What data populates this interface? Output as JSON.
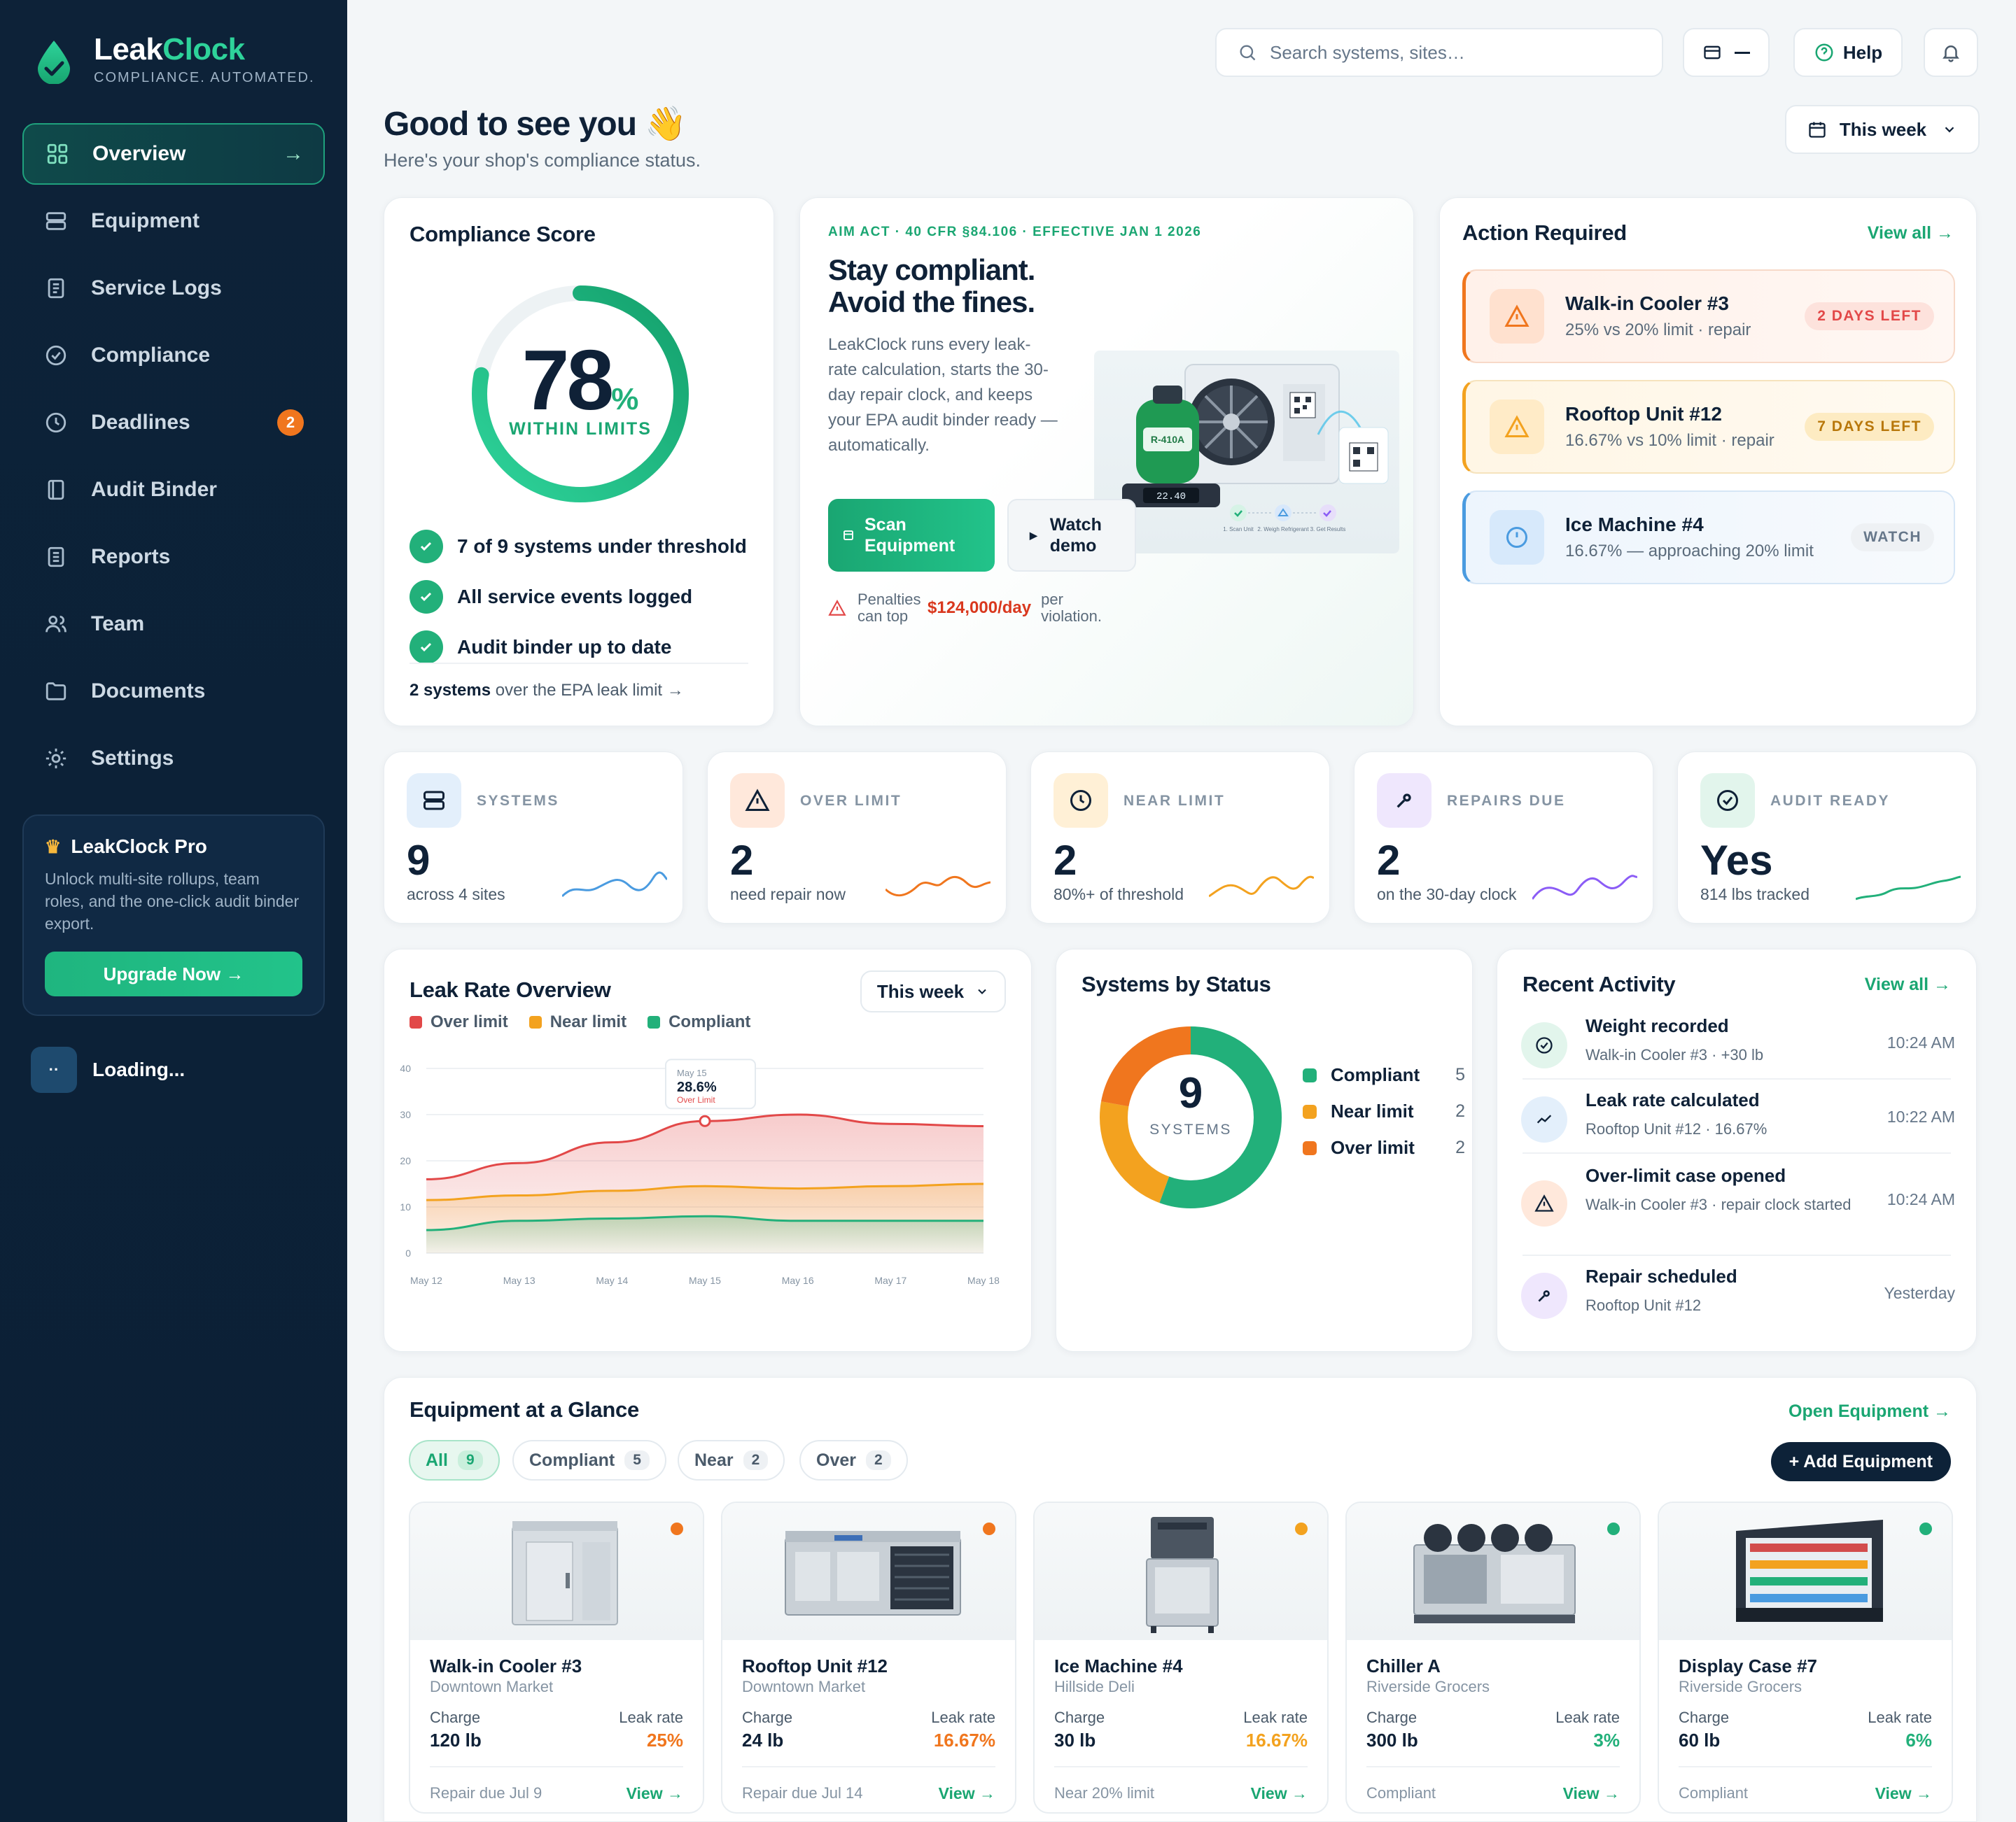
{
  "app": {
    "name_a": "Leak",
    "name_b": "Clock",
    "tagline": "COMPLIANCE. AUTOMATED."
  },
  "sidebar": {
    "items": [
      {
        "label": "Overview",
        "icon": "grid-icon",
        "active": true,
        "arrow": "→"
      },
      {
        "label": "Equipment",
        "icon": "server-icon"
      },
      {
        "label": "Service Logs",
        "icon": "document-icon"
      },
      {
        "label": "Compliance",
        "icon": "check-circle-icon"
      },
      {
        "label": "Deadlines",
        "icon": "clock-icon",
        "badge": "2"
      },
      {
        "label": "Audit Binder",
        "icon": "binder-icon"
      },
      {
        "label": "Reports",
        "icon": "report-icon"
      },
      {
        "label": "Team",
        "icon": "team-icon"
      },
      {
        "label": "Documents",
        "icon": "folder-icon"
      },
      {
        "label": "Settings",
        "icon": "gear-icon"
      }
    ],
    "pro": {
      "title": "LeakClock Pro",
      "desc": "Unlock multi-site rollups, team roles, and the one-click audit binder export.",
      "button": "Upgrade Now →"
    },
    "loading": {
      "dots": "··",
      "label": "Loading..."
    }
  },
  "topbar": {
    "search_placeholder": "Search systems, sites…",
    "help": "Help",
    "range": "This week"
  },
  "header": {
    "title": "Good to see you 👋",
    "subtitle": "Here's your shop's compliance status."
  },
  "score": {
    "title": "Compliance Score",
    "value": "78",
    "unit": "%",
    "percent": 78,
    "label": "WITHIN LIMITS",
    "checks": [
      "7 of 9 systems under threshold",
      "All service events logged",
      "Audit binder up to date"
    ],
    "footer_bold": "2 systems",
    "footer_rest": " over the EPA leak limit →"
  },
  "hero": {
    "eyebrow": "AIM ACT · 40 CFR §84.106 · EFFECTIVE JAN 1 2026",
    "title_1": "Stay compliant.",
    "title_2": "Avoid the fines.",
    "desc": "LeakClock runs every leak-rate calculation, starts the 30-day repair clock, and keeps your EPA audit binder ready — automatically.",
    "scan_btn": "Scan Equipment",
    "demo_btn": "Watch demo",
    "penalty_pre": "Penalties can top",
    "penalty_amount": "$124,000/day",
    "penalty_post": "per violation.",
    "illus": {
      "cylinder_label": "R-410A",
      "scale_readout": "22.40",
      "steps": [
        "1. Scan Unit",
        "2. Weigh Refrigerant",
        "3. Get Results"
      ]
    }
  },
  "actions": {
    "title": "Action Required",
    "view_all": "View all →",
    "items": [
      {
        "name": "Walk-in Cooler #3",
        "detail": "25% vs 20% limit · repair",
        "pill": "2 DAYS LEFT",
        "tone": "red"
      },
      {
        "name": "Rooftop Unit #12",
        "detail": "16.67% vs 10% limit · repair",
        "pill": "7 DAYS LEFT",
        "tone": "amber"
      },
      {
        "name": "Ice Machine #4",
        "detail": "16.67% — approaching 20% limit",
        "pill": "WATCH",
        "tone": "blue"
      }
    ]
  },
  "stats": [
    {
      "label": "SYSTEMS",
      "value": "9",
      "sub": "across 4 sites",
      "icon": "server-icon",
      "color": "#4a9be0"
    },
    {
      "label": "OVER LIMIT",
      "value": "2",
      "sub": "need repair now",
      "icon": "warning-icon",
      "color": "#f0761e"
    },
    {
      "label": "NEAR LIMIT",
      "value": "2",
      "sub": "80%+ of threshold",
      "icon": "clock-icon",
      "color": "#f3a21f"
    },
    {
      "label": "REPAIRS DUE",
      "value": "2",
      "sub": "on the 30-day clock",
      "icon": "wrench-icon",
      "color": "#8b5cf6"
    },
    {
      "label": "AUDIT READY",
      "value": "Yes",
      "sub": "814 lbs tracked",
      "icon": "check-circle-icon",
      "color": "#22b07a"
    }
  ],
  "leak_chart": {
    "title": "Leak Rate Overview",
    "range": "This week",
    "tooltip": {
      "date": "May 15",
      "value": "28.6%",
      "status": "Over Limit"
    },
    "yticks": [
      "40",
      "30",
      "20",
      "10",
      "0"
    ],
    "chart_data": {
      "type": "area",
      "x": [
        "May 12",
        "May 13",
        "May 14",
        "May 15",
        "May 16",
        "May 17",
        "May 18"
      ],
      "ylim": [
        0,
        40
      ],
      "series": [
        {
          "name": "Over limit",
          "color": "#e24848",
          "values": [
            16,
            19.5,
            24,
            28.6,
            30,
            28,
            27.5
          ]
        },
        {
          "name": "Near limit",
          "color": "#f3a21f",
          "values": [
            11.5,
            12.5,
            13.5,
            14.5,
            14,
            14.5,
            15
          ]
        },
        {
          "name": "Compliant",
          "color": "#22b07a",
          "values": [
            5,
            7,
            7.5,
            8,
            7,
            7,
            7
          ]
        }
      ]
    }
  },
  "status_card": {
    "title": "Systems by Status",
    "total": "9",
    "total_label": "SYSTEMS",
    "chart_data": {
      "type": "pie",
      "categories": [
        "Compliant",
        "Near limit",
        "Over limit"
      ],
      "values": [
        5,
        2,
        2
      ],
      "colors": [
        "#22b07a",
        "#f3a21f",
        "#f0761e"
      ]
    }
  },
  "activity": {
    "title": "Recent Activity",
    "view_all": "View all →",
    "items": [
      {
        "title": "Weight recorded",
        "sub": "Walk-in Cooler #3 · +30 lb",
        "time": "10:24 AM",
        "icon": "check-circle-icon"
      },
      {
        "title": "Leak rate calculated",
        "sub": "Rooftop Unit #12 · 16.67%",
        "time": "10:22 AM",
        "icon": "trend-icon"
      },
      {
        "title": "Over-limit case opened",
        "sub": "Walk-in Cooler #3 · repair clock started",
        "time": "10:24 AM",
        "icon": "warning-icon"
      },
      {
        "title": "Repair scheduled",
        "sub": "Rooftop Unit #12",
        "time": "Yesterday",
        "icon": "wrench-icon"
      }
    ]
  },
  "equipment": {
    "title": "Equipment at a Glance",
    "open": "Open Equipment →",
    "add": "+ Add Equipment",
    "filters": [
      {
        "label": "All",
        "count": "9",
        "active": true
      },
      {
        "label": "Compliant",
        "count": "5"
      },
      {
        "label": "Near",
        "count": "2"
      },
      {
        "label": "Over",
        "count": "2"
      }
    ],
    "items": [
      {
        "name": "Walk-in Cooler #3",
        "site": "Downtown Market",
        "charge_label": "Charge",
        "charge": "120 lb",
        "leak_label": "Leak rate",
        "leak": "25%",
        "foot": "Repair due Jul 9",
        "view": "View →",
        "status_color": "#f0761e",
        "leak_color": "#f0761e",
        "img": "walkin-cooler-icon"
      },
      {
        "name": "Rooftop Unit #12",
        "site": "Downtown Market",
        "charge_label": "Charge",
        "charge": "24 lb",
        "leak_label": "Leak rate",
        "leak": "16.67%",
        "foot": "Repair due Jul 14",
        "view": "View →",
        "status_color": "#f0761e",
        "leak_color": "#f0761e",
        "img": "rooftop-unit-icon"
      },
      {
        "name": "Ice Machine #4",
        "site": "Hillside Deli",
        "charge_label": "Charge",
        "charge": "30 lb",
        "leak_label": "Leak rate",
        "leak": "16.67%",
        "foot": "Near 20% limit",
        "view": "View →",
        "status_color": "#f3a21f",
        "leak_color": "#f3a21f",
        "img": "ice-machine-icon"
      },
      {
        "name": "Chiller A",
        "site": "Riverside Grocers",
        "charge_label": "Charge",
        "charge": "300 lb",
        "leak_label": "Leak rate",
        "leak": "3%",
        "foot": "Compliant",
        "view": "View →",
        "status_color": "#22b07a",
        "leak_color": "#22b07a",
        "img": "chiller-icon"
      },
      {
        "name": "Display Case #7",
        "site": "Riverside Grocers",
        "charge_label": "Charge",
        "charge": "60 lb",
        "leak_label": "Leak rate",
        "leak": "6%",
        "foot": "Compliant",
        "view": "View →",
        "status_color": "#22b07a",
        "leak_color": "#22b07a",
        "img": "display-case-icon"
      }
    ]
  }
}
